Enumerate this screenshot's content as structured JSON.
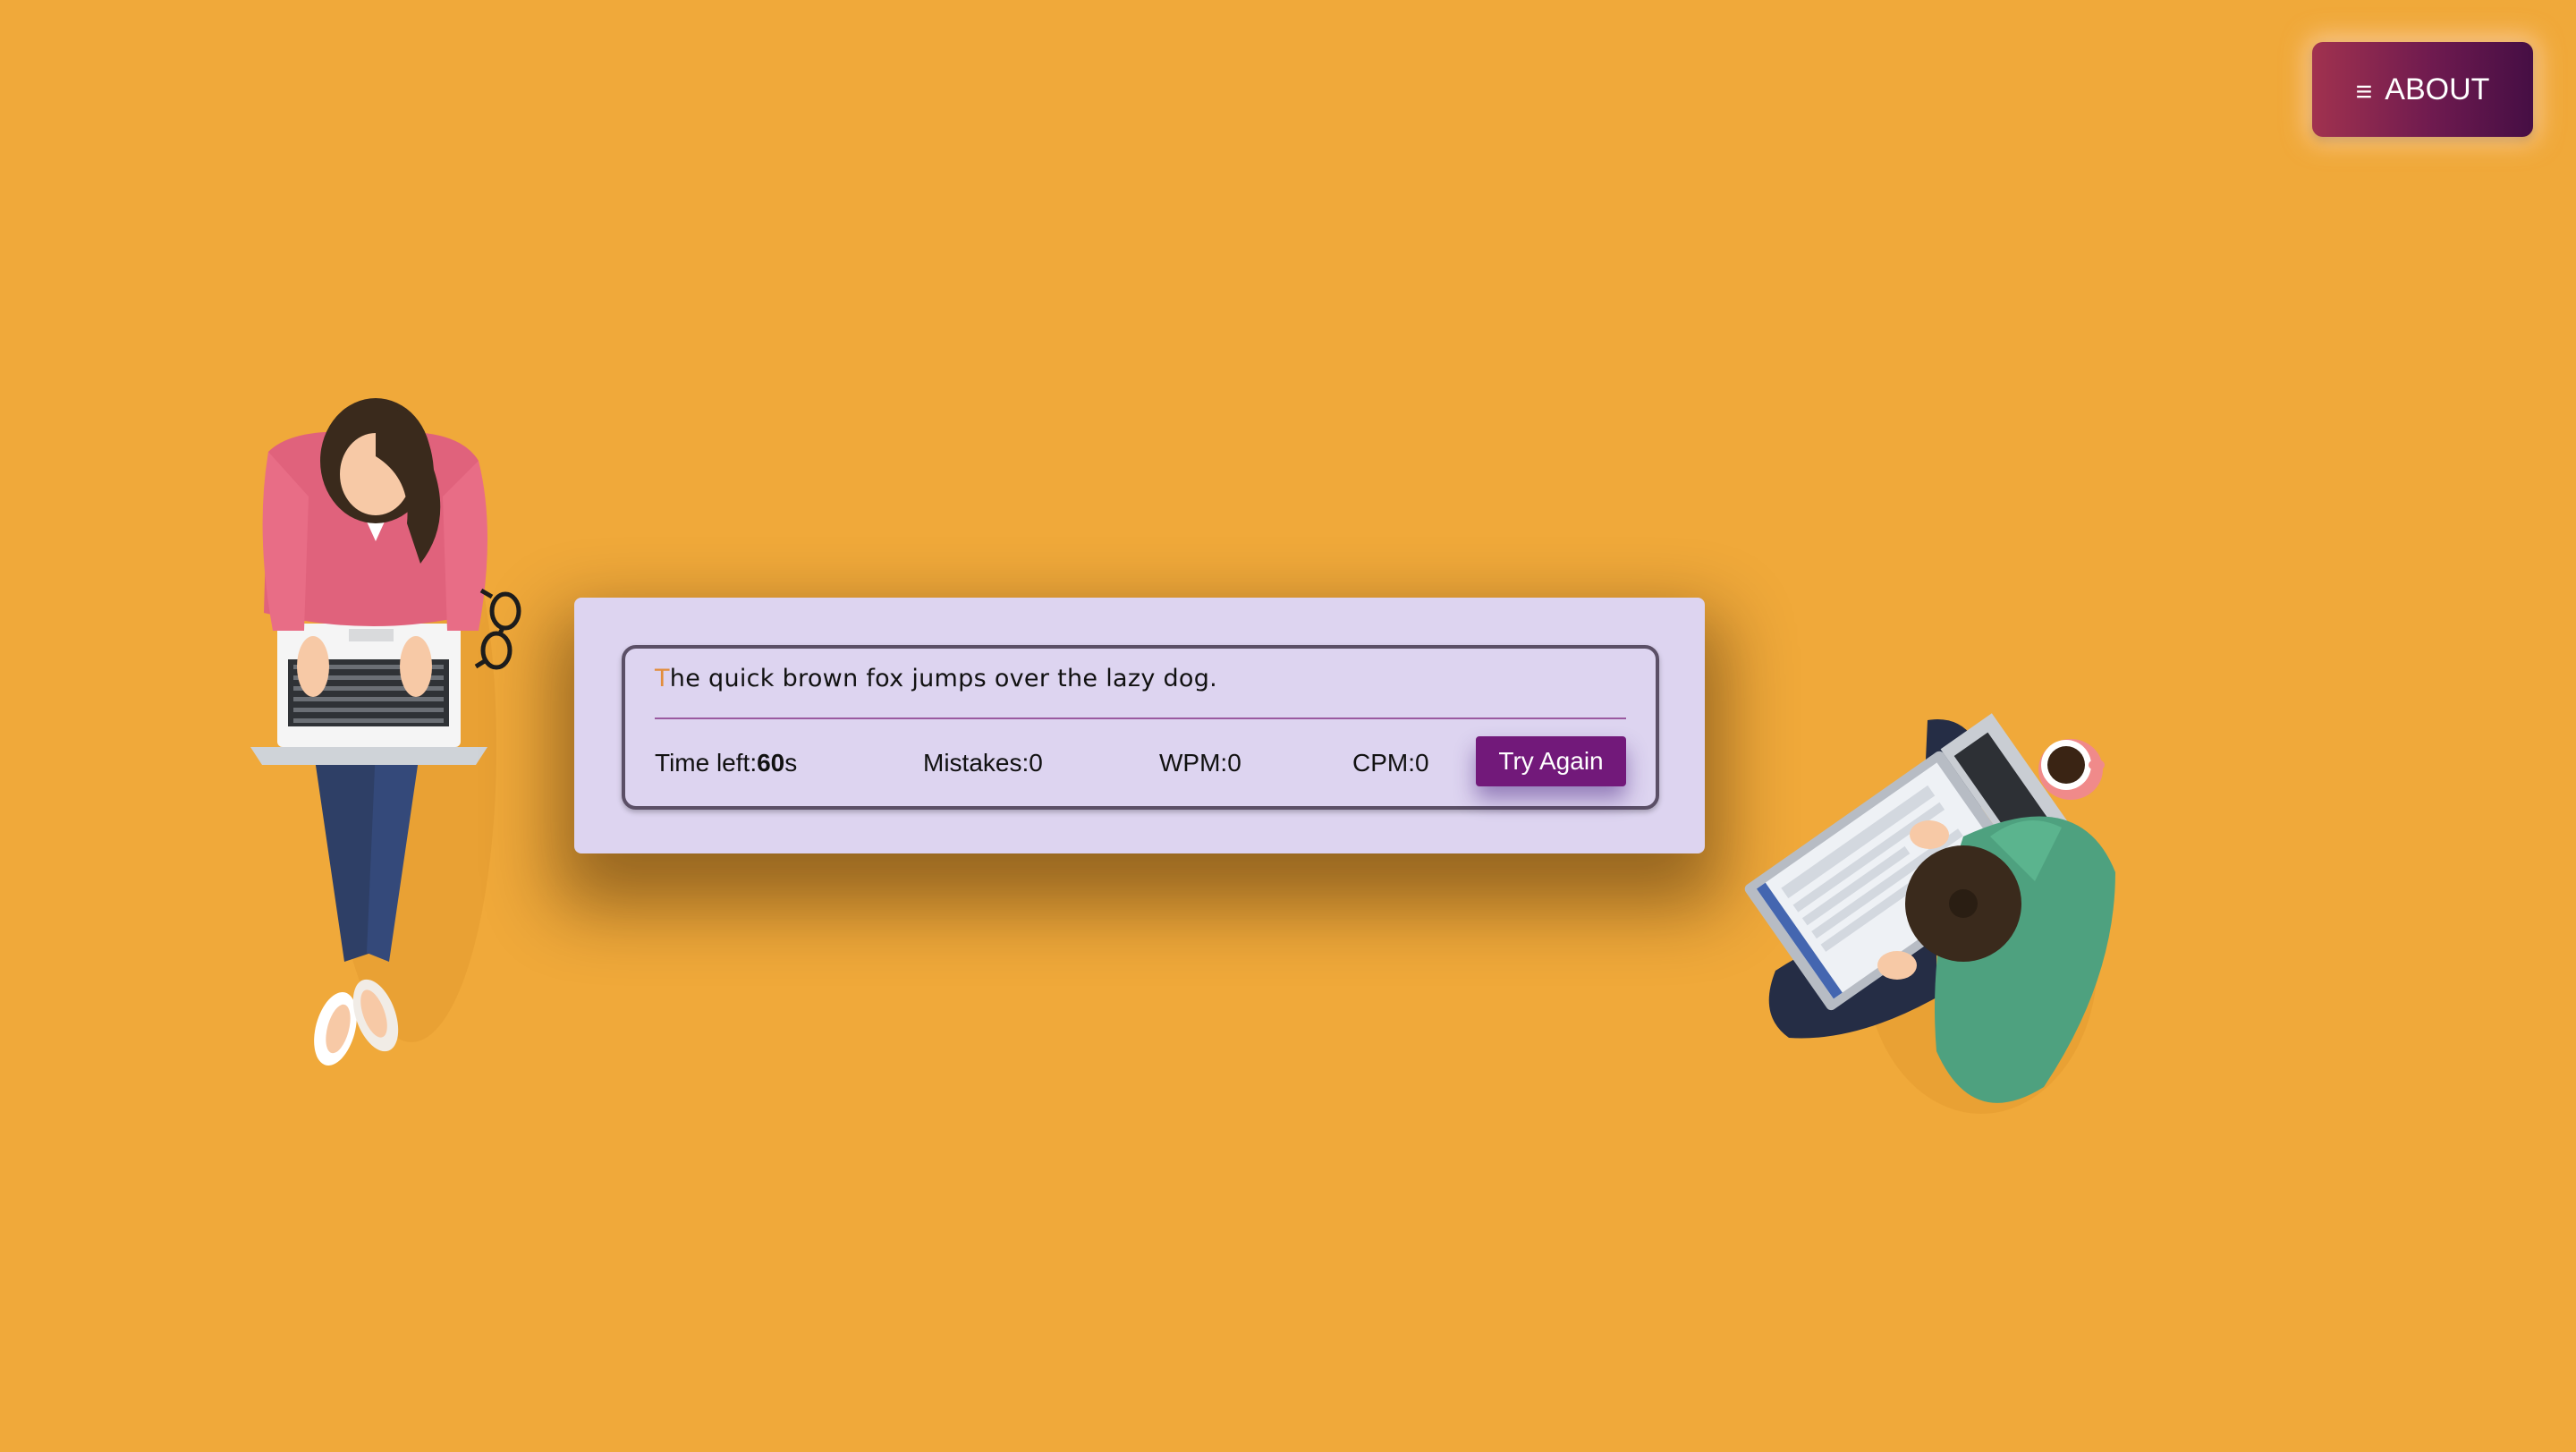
{
  "about_button": {
    "icon": "menu-icon",
    "glyph": "≡",
    "label": "ABOUT"
  },
  "typing_test": {
    "passage_first_char": "T",
    "passage_rest": "he quick brown fox jumps over the lazy dog.",
    "stats": {
      "time_label": "Time left:",
      "time_value": "60",
      "time_unit": "s",
      "mistakes_label": "Mistakes:",
      "mistakes_value": "0",
      "wpm_label": "WPM:",
      "wpm_value": "0",
      "cpm_label": "CPM:",
      "cpm_value": "0"
    },
    "try_again_label": "Try Again"
  },
  "colors": {
    "background": "#f0a93a",
    "card": "#ddd4f0",
    "accent_button": "#72197a",
    "highlight_char": "#e28d3b",
    "about_gradient_start": "#a1324f",
    "about_gradient_end": "#450e44"
  },
  "illustrations": {
    "left": "woman-typing-on-laptop-illustration",
    "right": "man-typing-on-laptop-with-coffee-illustration"
  }
}
